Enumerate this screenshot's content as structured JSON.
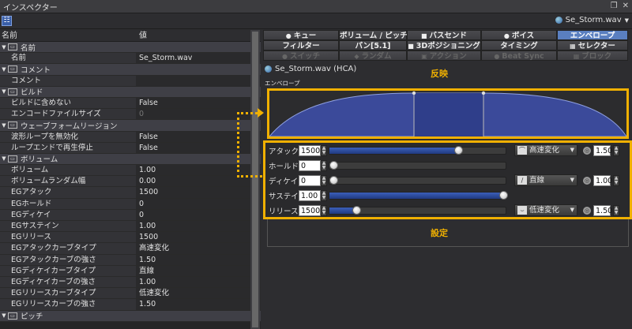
{
  "window": {
    "title": "インスペクター"
  },
  "toolbar": {
    "cue_name": "Se_Storm.wav"
  },
  "left": {
    "col_name": "名前",
    "col_value": "値",
    "groups": [
      {
        "label": "名前",
        "icon": "name-group-icon",
        "rows": [
          {
            "k": "名前",
            "v": "Se_Storm.wav",
            "dim": false
          }
        ]
      },
      {
        "label": "コメント",
        "icon": "comment-group-icon",
        "rows": [
          {
            "k": "コメント",
            "v": "",
            "dim": false
          }
        ]
      },
      {
        "label": "ビルド",
        "icon": "build-group-icon",
        "rows": [
          {
            "k": "ビルドに含めない",
            "v": "False",
            "dim": false
          },
          {
            "k": "エンコードファイルサイズ",
            "v": "0",
            "dim": true
          }
        ]
      },
      {
        "label": "ウェーブフォームリージョン",
        "icon": "waveform-group-icon",
        "rows": [
          {
            "k": "波形ループを無効化",
            "v": "False",
            "dim": false
          },
          {
            "k": "ループエンドで再生停止",
            "v": "False",
            "dim": false
          }
        ]
      },
      {
        "label": "ボリューム",
        "icon": "volume-group-icon",
        "rows": [
          {
            "k": "ボリューム",
            "v": "1.00",
            "dim": false
          },
          {
            "k": "ボリュームランダム幅",
            "v": "0.00",
            "dim": false
          },
          {
            "k": "EGアタック",
            "v": "1500",
            "dim": false
          },
          {
            "k": "EGホールド",
            "v": "0",
            "dim": false
          },
          {
            "k": "EGディケイ",
            "v": "0",
            "dim": false
          },
          {
            "k": "EGサステイン",
            "v": "1.00",
            "dim": false
          },
          {
            "k": "EGリリース",
            "v": "1500",
            "dim": false
          },
          {
            "k": "EGアタックカーブタイプ",
            "v": "高速変化",
            "dim": false
          },
          {
            "k": "EGアタックカーブの強さ",
            "v": "1.50",
            "dim": false
          },
          {
            "k": "EGディケイカーブタイプ",
            "v": "直線",
            "dim": false
          },
          {
            "k": "EGディケイカーブの強さ",
            "v": "1.00",
            "dim": false
          },
          {
            "k": "EGリリースカーブタイプ",
            "v": "低速変化",
            "dim": false
          },
          {
            "k": "EGリリースカーブの強さ",
            "v": "1.50",
            "dim": false
          }
        ]
      },
      {
        "label": "ピッチ",
        "icon": "pitch-group-icon",
        "rows": []
      }
    ]
  },
  "tabs": {
    "cue": "キュー",
    "volume_pitch": "ボリューム / ピッチ",
    "bus_send": "バスセンド",
    "voice": "ボイス",
    "envelope": "エンベロープ",
    "filter": "フィルター",
    "pan": "パン[5.1]",
    "3d": "3Dポジショニング",
    "timing": "タイミング",
    "selector": "セレクター",
    "switch": "スイッチ",
    "random": "ランダム",
    "action": "アクション",
    "beat_sync": "Beat Sync",
    "block": "ブロック"
  },
  "header": {
    "title": "Se_Storm.wav (HCA)",
    "envelope_label": "エンベロープ"
  },
  "annotations": {
    "reflect": "反映",
    "settings": "設定"
  },
  "envelope": {
    "attack": 1500,
    "hold": 0,
    "decay": 0,
    "sustain": 1.0,
    "release": 1500
  },
  "params": {
    "attack": {
      "label": "アタック",
      "value": "1500",
      "fill": 0.74,
      "curve": "高速変化",
      "strength": "1.50"
    },
    "hold": {
      "label": "ホールド",
      "value": "0",
      "fill": 0.0
    },
    "decay": {
      "label": "ディケイ",
      "value": "0",
      "fill": 0.0,
      "curve": "直線",
      "strength": "1.00"
    },
    "sustain": {
      "label": "サステイン",
      "value": "1.00",
      "fill": 1.0
    },
    "release": {
      "label": "リリース",
      "value": "1500",
      "fill": 0.16,
      "curve": "低速変化",
      "strength": "1.50"
    }
  },
  "colors": {
    "accent": "#f0b000",
    "fill": "#3b4a9a",
    "active_tab": "#5a7fc0"
  }
}
